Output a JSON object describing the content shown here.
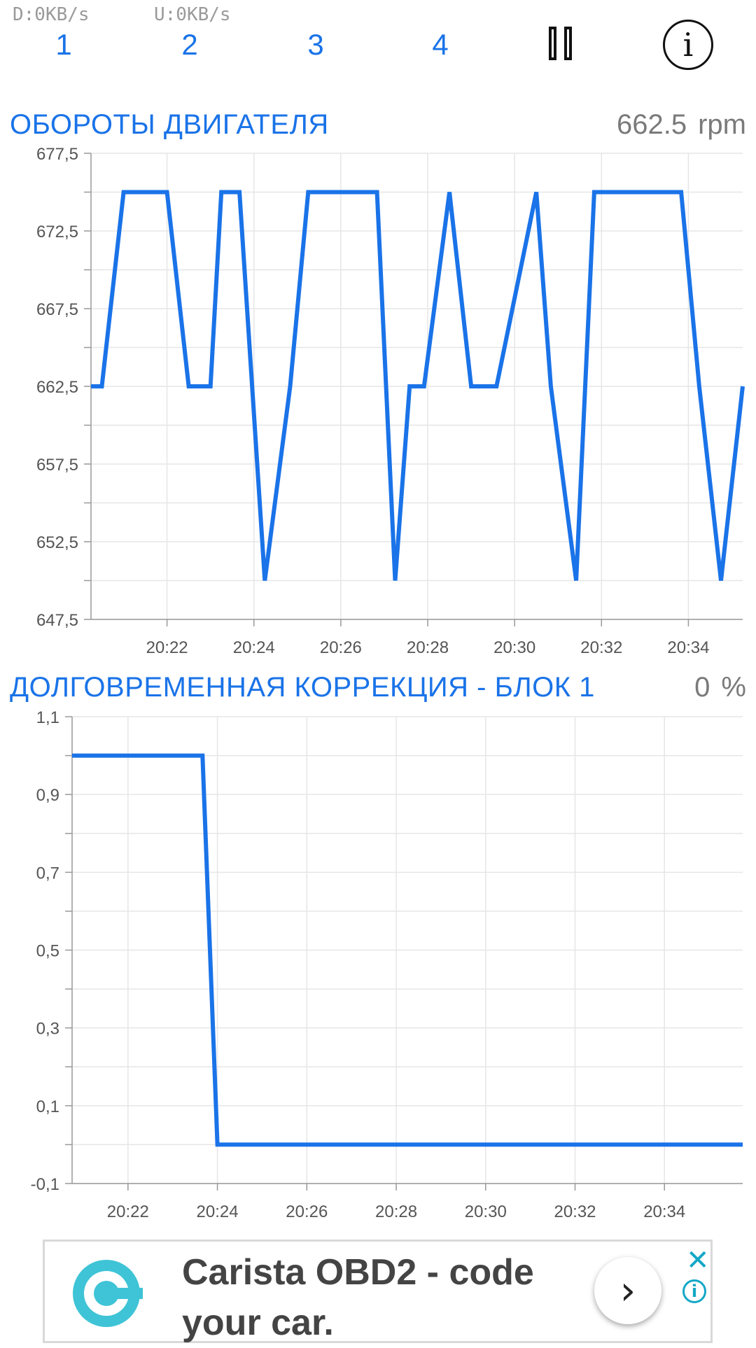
{
  "status": {
    "download": "D:0KB/s",
    "upload": "U:0KB/s"
  },
  "tabs": [
    "1",
    "2",
    "3",
    "4"
  ],
  "toolbar": {
    "pause_icon": "pause-icon",
    "info_icon": "info-icon",
    "info_glyph": "i"
  },
  "colors": {
    "accent": "#1a73e8",
    "line": "#1a73e8",
    "grid": "#e6e6e6",
    "ad_accent": "#14a7c6"
  },
  "chart_data": [
    {
      "type": "line",
      "title": "ОБОРОТЫ ДВИГАТЕЛЯ",
      "current_value": "662.5",
      "unit": "rpm",
      "y_ticks": [
        "677,5",
        "672,5",
        "667,5",
        "662,5",
        "657,5",
        "652,5",
        "647,5"
      ],
      "x_ticks": [
        "20:22",
        "20:24",
        "20:26",
        "20:28",
        "20:30",
        "20:32",
        "20:34"
      ],
      "ylim": [
        647.5,
        677.5
      ],
      "xlim": [
        "20:20:15",
        "20:35:15"
      ],
      "grid": true,
      "series": [
        {
          "x": [
            "20:20:15",
            "20:20:30",
            "20:21:00",
            "20:22:00",
            "20:22:30",
            "20:23:00",
            "20:23:15",
            "20:23:40",
            "20:24:15",
            "20:24:50",
            "20:25:15",
            "20:26:50",
            "20:27:15",
            "20:27:35",
            "20:27:55",
            "20:28:30",
            "20:29:00",
            "20:29:35",
            "20:30:30",
            "20:30:50",
            "20:31:25",
            "20:31:50",
            "20:33:50",
            "20:34:15",
            "20:34:45",
            "20:35:15"
          ],
          "y": [
            662.5,
            662.5,
            675,
            675,
            662.5,
            662.5,
            675,
            675,
            650,
            662.5,
            675,
            675,
            650,
            662.5,
            662.5,
            675,
            662.5,
            662.5,
            675,
            662.5,
            650,
            675,
            675,
            662.5,
            650,
            662.5
          ]
        }
      ]
    },
    {
      "type": "line",
      "title": "ДОЛГОВРЕМЕННАЯ КОРРЕКЦИЯ - БЛОК 1",
      "current_value": "0",
      "unit": "%",
      "y_ticks": [
        "1,1",
        "0,9",
        "0,7",
        "0,5",
        "0,3",
        "0,1",
        "-0,1"
      ],
      "x_ticks": [
        "20:22",
        "20:24",
        "20:26",
        "20:28",
        "20:30",
        "20:32",
        "20:34"
      ],
      "ylim": [
        -0.1,
        1.1
      ],
      "xlim": [
        "20:20:45",
        "20:35:45"
      ],
      "grid": true,
      "series": [
        {
          "x": [
            "20:20:45",
            "20:23:40",
            "20:24:00",
            "20:35:45"
          ],
          "y": [
            1.0,
            1.0,
            0.0,
            0.0
          ]
        }
      ]
    }
  ],
  "ad": {
    "text": "Carista OBD2 - code your car.",
    "arrow_glyph": "›",
    "close_glyph": "✕",
    "info_glyph": "i",
    "logo_icon": "carista-logo-icon"
  }
}
